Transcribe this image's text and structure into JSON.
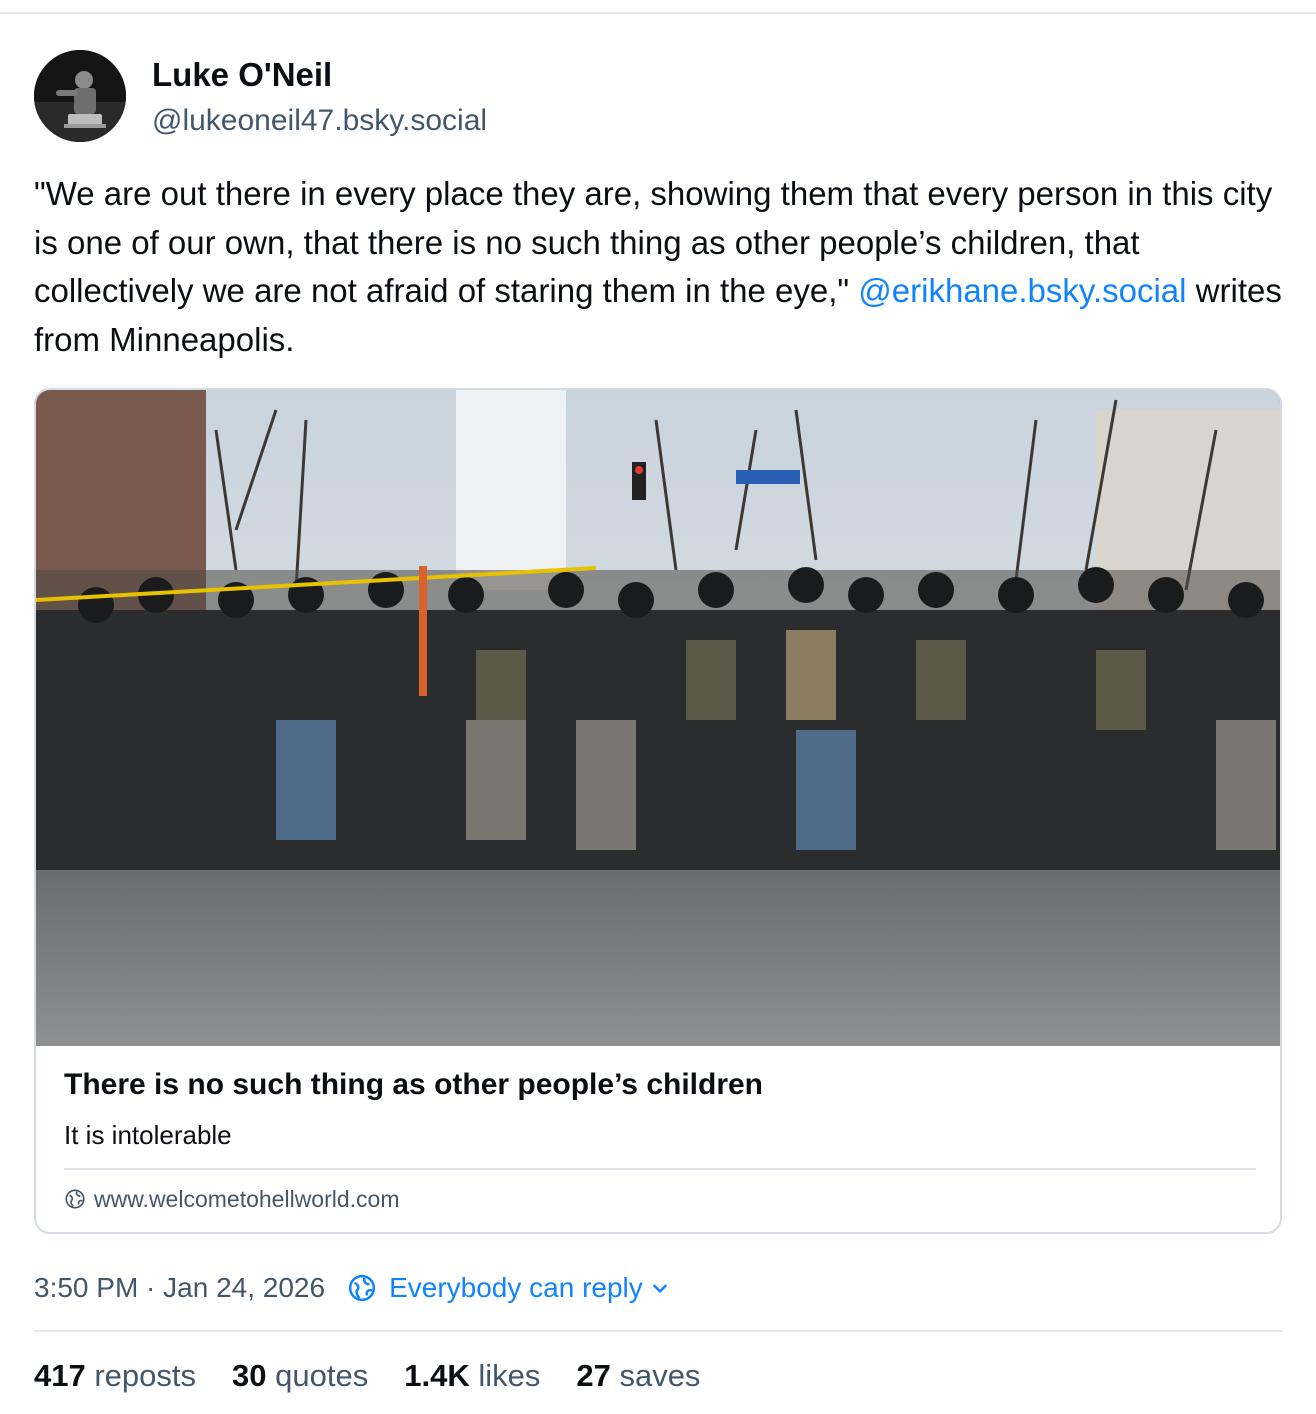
{
  "post": {
    "author": {
      "name": "Luke O'Neil",
      "handle": "@lukeoneil47.bsky.social"
    },
    "text": {
      "before_mention": "\"We are out there in every place they are, showing them that every person in this city is one of our own, that there is no such thing as other people’s children, that collectively we are not afraid of staring them in the eye,\" ",
      "mention": "@erikhane.bsky.social",
      "after_mention": " writes from Minneapolis."
    },
    "link_card": {
      "title": "There is no such thing as other people’s children",
      "description": "It is intolerable",
      "domain": "www.welcometohellworld.com",
      "domain_icon": "globe-icon"
    },
    "meta": {
      "timestamp": "3:50 PM · Jan 24, 2026",
      "reply_setting": "Everybody can reply",
      "reply_icon": "globe-icon"
    },
    "stats": [
      {
        "count": "417",
        "label": "reposts"
      },
      {
        "count": "30",
        "label": "quotes"
      },
      {
        "count": "1.4K",
        "label": "likes"
      },
      {
        "count": "27",
        "label": "saves"
      }
    ]
  },
  "colors": {
    "link": "#1083fe",
    "muted": "#42576c",
    "text": "#0b0f14",
    "border": "#d4dbe2"
  }
}
